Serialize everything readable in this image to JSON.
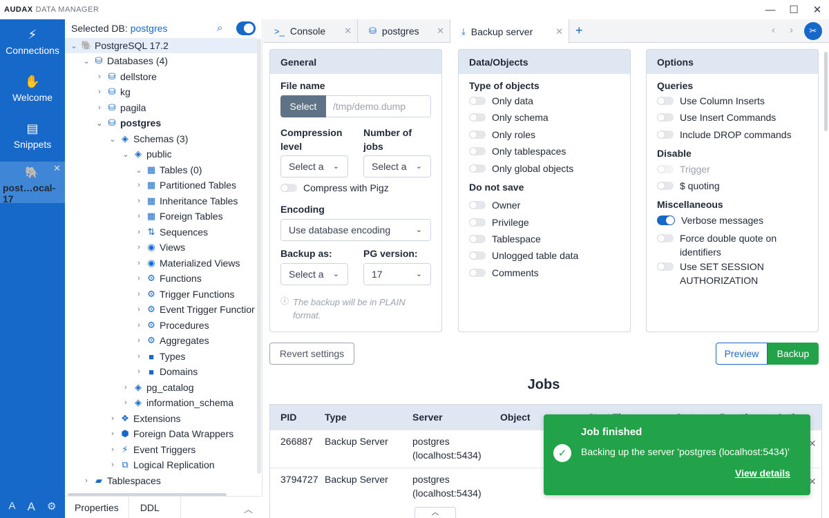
{
  "app": {
    "brand_bold": "AUDAX",
    "brand_rest": "DATA MANAGER"
  },
  "window": {
    "minimize": "—",
    "maximize": "☐",
    "close": "✕"
  },
  "rail": {
    "connections": "Connections",
    "welcome": "Welcome",
    "snippets": "Snippets",
    "active_connection": "post…ocal-17"
  },
  "tree": {
    "selected_db_label": "Selected DB:",
    "selected_db": "postgres",
    "rows": {
      "server": "PostgreSQL 17.2",
      "databases": "Databases (4)",
      "dellstore": "dellstore",
      "kg": "kg",
      "pagila": "pagila",
      "postgres": "postgres",
      "schemas": "Schemas (3)",
      "public": "public",
      "tables": "Tables (0)",
      "partitioned": "Partitioned Tables",
      "inheritance": "Inheritance Tables",
      "foreign_tables": "Foreign Tables",
      "sequences": "Sequences",
      "views": "Views",
      "mat_views": "Materialized Views",
      "functions": "Functions",
      "trigger_functions": "Trigger Functions",
      "event_trigger_functions": "Event Trigger Functior",
      "procedures": "Procedures",
      "aggregates": "Aggregates",
      "types": "Types",
      "domains": "Domains",
      "pg_catalog": "pg_catalog",
      "information_schema": "information_schema",
      "extensions": "Extensions",
      "fdw": "Foreign Data Wrappers",
      "event_triggers": "Event Triggers",
      "logical_replication": "Logical Replication",
      "tablespaces": "Tablespaces"
    },
    "bottom_tabs": [
      "Properties",
      "DDL"
    ]
  },
  "tabs": [
    {
      "label": "Console"
    },
    {
      "label": "postgres"
    },
    {
      "label": "Backup server"
    }
  ],
  "general": {
    "title": "General",
    "file_name_label": "File name",
    "select_button": "Select",
    "file_placeholder": "/tmp/demo.dump",
    "compression_label": "Compression level",
    "compression_value": "Select a",
    "jobs_label": "Number of jobs",
    "jobs_value": "Select a",
    "compress_pigz": "Compress with Pigz",
    "encoding_label": "Encoding",
    "encoding_value": "Use database encoding",
    "backup_as_label": "Backup as:",
    "backup_as_value": "Select a",
    "pg_version_label": "PG version:",
    "pg_version_value": "17",
    "note": "The backup will be in PLAIN format."
  },
  "data_objects": {
    "title": "Data/Objects",
    "type_label": "Type of objects",
    "types": [
      "Only data",
      "Only schema",
      "Only roles",
      "Only tablespaces",
      "Only global objects"
    ],
    "do_not_save_label": "Do not save",
    "do_not_save": [
      "Owner",
      "Privilege",
      "Tablespace",
      "Unlogged table data",
      "Comments"
    ]
  },
  "options": {
    "title": "Options",
    "queries_label": "Queries",
    "queries": [
      "Use Column Inserts",
      "Use Insert Commands",
      "Include DROP commands"
    ],
    "disable_label": "Disable",
    "trigger": "Trigger",
    "quoting": "$ quoting",
    "misc_label": "Miscellaneous",
    "verbose": "Verbose messages",
    "verbose_on": true,
    "force_quote": "Force double quote on identifiers",
    "set_session": "Use SET SESSION AUTHORIZATION"
  },
  "actions": {
    "revert": "Revert settings",
    "preview": "Preview",
    "backup": "Backup"
  },
  "jobs": {
    "title": "Jobs",
    "columns": [
      "PID",
      "Type",
      "Server",
      "Object",
      "Start Ti…",
      "Stat…",
      "Duration",
      "Actio…"
    ],
    "rows": [
      {
        "pid": "266887",
        "type": "Backup Server",
        "server": "postgres (localhost:5434)"
      },
      {
        "pid": "3794727",
        "type": "Backup Server",
        "server": "postgres (localhost:5434)"
      }
    ]
  },
  "toast": {
    "title": "Job finished",
    "message": "Backing up the server 'postgres (localhost:5434)'",
    "link": "View details"
  },
  "colors": {
    "primary": "#1668c9",
    "success": "#22a34a",
    "header_bg": "#dfe8f2"
  }
}
